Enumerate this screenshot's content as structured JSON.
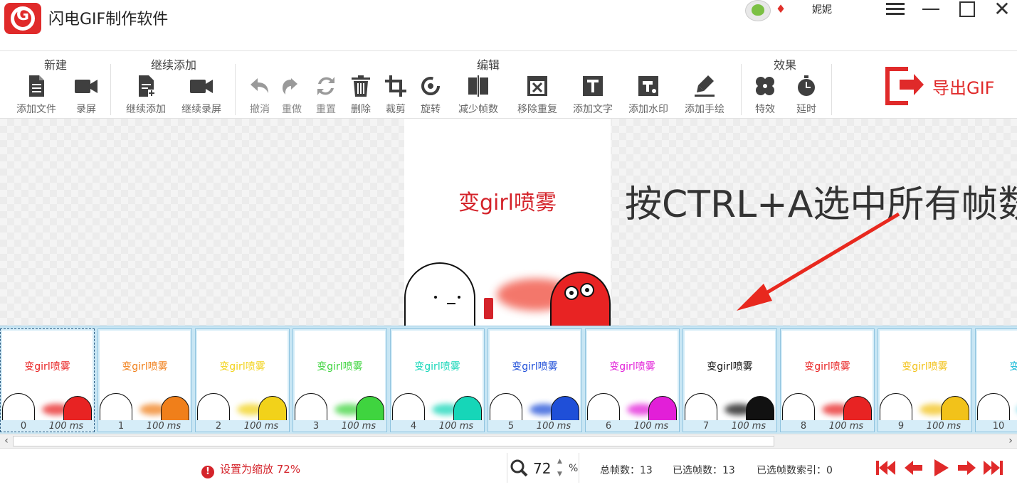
{
  "app": {
    "title": "闪电GIF制作软件",
    "username": "妮妮",
    "logo_letter": "G"
  },
  "toolbar": {
    "groups": {
      "new": "新建",
      "continue_add": "继续添加",
      "edit": "编辑",
      "effects": "效果"
    },
    "tools": {
      "add_file": "添加文件",
      "record": "录屏",
      "continue_add": "继续添加",
      "continue_record": "继续录屏",
      "undo": "撤消",
      "redo": "重做",
      "reset": "重置",
      "delete": "删除",
      "crop": "裁剪",
      "rotate": "旋转",
      "reduce_frames": "减少帧数",
      "remove_duplicates": "移除重复",
      "add_text": "添加文字",
      "add_watermark": "添加水印",
      "add_drawing": "添加手绘",
      "effects": "特效",
      "delay": "延时"
    },
    "export": "导出GIF"
  },
  "canvas": {
    "preview_text": "变girl喷雾",
    "annotation": "按CTRL+A选中所有帧数"
  },
  "frames": [
    {
      "index": "0",
      "duration": "100 ms",
      "text": "变girl喷雾",
      "color": "#e82323"
    },
    {
      "index": "1",
      "duration": "100 ms",
      "text": "变girl喷雾",
      "color": "#f07f1a"
    },
    {
      "index": "2",
      "duration": "100 ms",
      "text": "变girl喷雾",
      "color": "#f2d21a"
    },
    {
      "index": "3",
      "duration": "100 ms",
      "text": "变girl喷雾",
      "color": "#3fd43f"
    },
    {
      "index": "4",
      "duration": "100 ms",
      "text": "变girl喷雾",
      "color": "#16d6b8"
    },
    {
      "index": "5",
      "duration": "100 ms",
      "text": "变girl喷雾",
      "color": "#1f4fd8"
    },
    {
      "index": "6",
      "duration": "100 ms",
      "text": "变girl喷雾",
      "color": "#e21fd8"
    },
    {
      "index": "7",
      "duration": "100 ms",
      "text": "变girl喷雾",
      "color": "#111111"
    },
    {
      "index": "8",
      "duration": "100 ms",
      "text": "变girl喷雾",
      "color": "#e82323"
    },
    {
      "index": "9",
      "duration": "100 ms",
      "text": "变girl喷雾",
      "color": "#f2c21a"
    },
    {
      "index": "10",
      "duration": "",
      "text": "变girl",
      "color": "#16b8d6"
    }
  ],
  "status": {
    "message": "设置为缩放 72%",
    "zoom_value": "72",
    "zoom_unit": "%",
    "total_frames": "总帧数：13",
    "selected_frames": "已选帧数：13",
    "selected_index": "已选帧数索引：0"
  },
  "colors": {
    "accent": "#e02a2a",
    "strip_bg": "#c8e6f4",
    "preview_blob": "#e82323"
  }
}
